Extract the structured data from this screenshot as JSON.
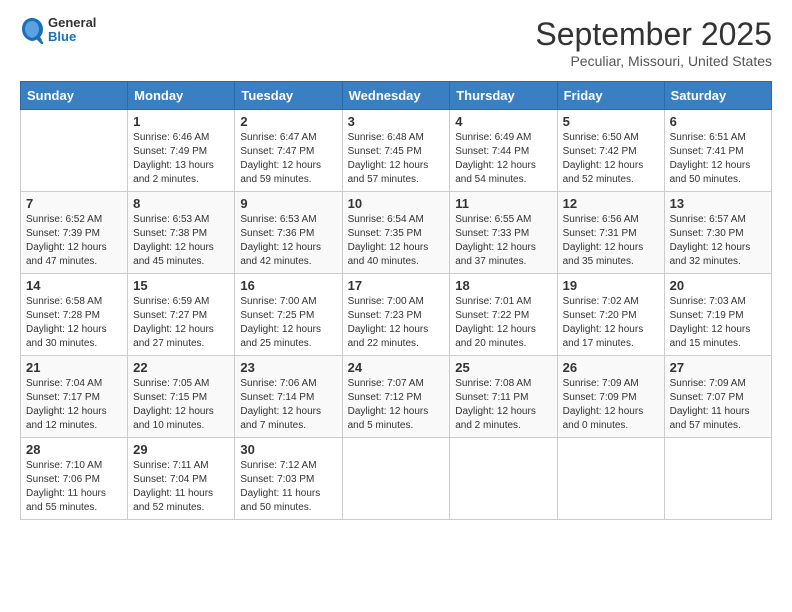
{
  "header": {
    "logo_general": "General",
    "logo_blue": "Blue",
    "month_title": "September 2025",
    "location": "Peculiar, Missouri, United States"
  },
  "days_of_week": [
    "Sunday",
    "Monday",
    "Tuesday",
    "Wednesday",
    "Thursday",
    "Friday",
    "Saturday"
  ],
  "weeks": [
    [
      {
        "day": "",
        "sunrise": "",
        "sunset": "",
        "daylight": ""
      },
      {
        "day": "1",
        "sunrise": "Sunrise: 6:46 AM",
        "sunset": "Sunset: 7:49 PM",
        "daylight": "Daylight: 13 hours and 2 minutes."
      },
      {
        "day": "2",
        "sunrise": "Sunrise: 6:47 AM",
        "sunset": "Sunset: 7:47 PM",
        "daylight": "Daylight: 12 hours and 59 minutes."
      },
      {
        "day": "3",
        "sunrise": "Sunrise: 6:48 AM",
        "sunset": "Sunset: 7:45 PM",
        "daylight": "Daylight: 12 hours and 57 minutes."
      },
      {
        "day": "4",
        "sunrise": "Sunrise: 6:49 AM",
        "sunset": "Sunset: 7:44 PM",
        "daylight": "Daylight: 12 hours and 54 minutes."
      },
      {
        "day": "5",
        "sunrise": "Sunrise: 6:50 AM",
        "sunset": "Sunset: 7:42 PM",
        "daylight": "Daylight: 12 hours and 52 minutes."
      },
      {
        "day": "6",
        "sunrise": "Sunrise: 6:51 AM",
        "sunset": "Sunset: 7:41 PM",
        "daylight": "Daylight: 12 hours and 50 minutes."
      }
    ],
    [
      {
        "day": "7",
        "sunrise": "Sunrise: 6:52 AM",
        "sunset": "Sunset: 7:39 PM",
        "daylight": "Daylight: 12 hours and 47 minutes."
      },
      {
        "day": "8",
        "sunrise": "Sunrise: 6:53 AM",
        "sunset": "Sunset: 7:38 PM",
        "daylight": "Daylight: 12 hours and 45 minutes."
      },
      {
        "day": "9",
        "sunrise": "Sunrise: 6:53 AM",
        "sunset": "Sunset: 7:36 PM",
        "daylight": "Daylight: 12 hours and 42 minutes."
      },
      {
        "day": "10",
        "sunrise": "Sunrise: 6:54 AM",
        "sunset": "Sunset: 7:35 PM",
        "daylight": "Daylight: 12 hours and 40 minutes."
      },
      {
        "day": "11",
        "sunrise": "Sunrise: 6:55 AM",
        "sunset": "Sunset: 7:33 PM",
        "daylight": "Daylight: 12 hours and 37 minutes."
      },
      {
        "day": "12",
        "sunrise": "Sunrise: 6:56 AM",
        "sunset": "Sunset: 7:31 PM",
        "daylight": "Daylight: 12 hours and 35 minutes."
      },
      {
        "day": "13",
        "sunrise": "Sunrise: 6:57 AM",
        "sunset": "Sunset: 7:30 PM",
        "daylight": "Daylight: 12 hours and 32 minutes."
      }
    ],
    [
      {
        "day": "14",
        "sunrise": "Sunrise: 6:58 AM",
        "sunset": "Sunset: 7:28 PM",
        "daylight": "Daylight: 12 hours and 30 minutes."
      },
      {
        "day": "15",
        "sunrise": "Sunrise: 6:59 AM",
        "sunset": "Sunset: 7:27 PM",
        "daylight": "Daylight: 12 hours and 27 minutes."
      },
      {
        "day": "16",
        "sunrise": "Sunrise: 7:00 AM",
        "sunset": "Sunset: 7:25 PM",
        "daylight": "Daylight: 12 hours and 25 minutes."
      },
      {
        "day": "17",
        "sunrise": "Sunrise: 7:00 AM",
        "sunset": "Sunset: 7:23 PM",
        "daylight": "Daylight: 12 hours and 22 minutes."
      },
      {
        "day": "18",
        "sunrise": "Sunrise: 7:01 AM",
        "sunset": "Sunset: 7:22 PM",
        "daylight": "Daylight: 12 hours and 20 minutes."
      },
      {
        "day": "19",
        "sunrise": "Sunrise: 7:02 AM",
        "sunset": "Sunset: 7:20 PM",
        "daylight": "Daylight: 12 hours and 17 minutes."
      },
      {
        "day": "20",
        "sunrise": "Sunrise: 7:03 AM",
        "sunset": "Sunset: 7:19 PM",
        "daylight": "Daylight: 12 hours and 15 minutes."
      }
    ],
    [
      {
        "day": "21",
        "sunrise": "Sunrise: 7:04 AM",
        "sunset": "Sunset: 7:17 PM",
        "daylight": "Daylight: 12 hours and 12 minutes."
      },
      {
        "day": "22",
        "sunrise": "Sunrise: 7:05 AM",
        "sunset": "Sunset: 7:15 PM",
        "daylight": "Daylight: 12 hours and 10 minutes."
      },
      {
        "day": "23",
        "sunrise": "Sunrise: 7:06 AM",
        "sunset": "Sunset: 7:14 PM",
        "daylight": "Daylight: 12 hours and 7 minutes."
      },
      {
        "day": "24",
        "sunrise": "Sunrise: 7:07 AM",
        "sunset": "Sunset: 7:12 PM",
        "daylight": "Daylight: 12 hours and 5 minutes."
      },
      {
        "day": "25",
        "sunrise": "Sunrise: 7:08 AM",
        "sunset": "Sunset: 7:11 PM",
        "daylight": "Daylight: 12 hours and 2 minutes."
      },
      {
        "day": "26",
        "sunrise": "Sunrise: 7:09 AM",
        "sunset": "Sunset: 7:09 PM",
        "daylight": "Daylight: 12 hours and 0 minutes."
      },
      {
        "day": "27",
        "sunrise": "Sunrise: 7:09 AM",
        "sunset": "Sunset: 7:07 PM",
        "daylight": "Daylight: 11 hours and 57 minutes."
      }
    ],
    [
      {
        "day": "28",
        "sunrise": "Sunrise: 7:10 AM",
        "sunset": "Sunset: 7:06 PM",
        "daylight": "Daylight: 11 hours and 55 minutes."
      },
      {
        "day": "29",
        "sunrise": "Sunrise: 7:11 AM",
        "sunset": "Sunset: 7:04 PM",
        "daylight": "Daylight: 11 hours and 52 minutes."
      },
      {
        "day": "30",
        "sunrise": "Sunrise: 7:12 AM",
        "sunset": "Sunset: 7:03 PM",
        "daylight": "Daylight: 11 hours and 50 minutes."
      },
      {
        "day": "",
        "sunrise": "",
        "sunset": "",
        "daylight": ""
      },
      {
        "day": "",
        "sunrise": "",
        "sunset": "",
        "daylight": ""
      },
      {
        "day": "",
        "sunrise": "",
        "sunset": "",
        "daylight": ""
      },
      {
        "day": "",
        "sunrise": "",
        "sunset": "",
        "daylight": ""
      }
    ]
  ]
}
